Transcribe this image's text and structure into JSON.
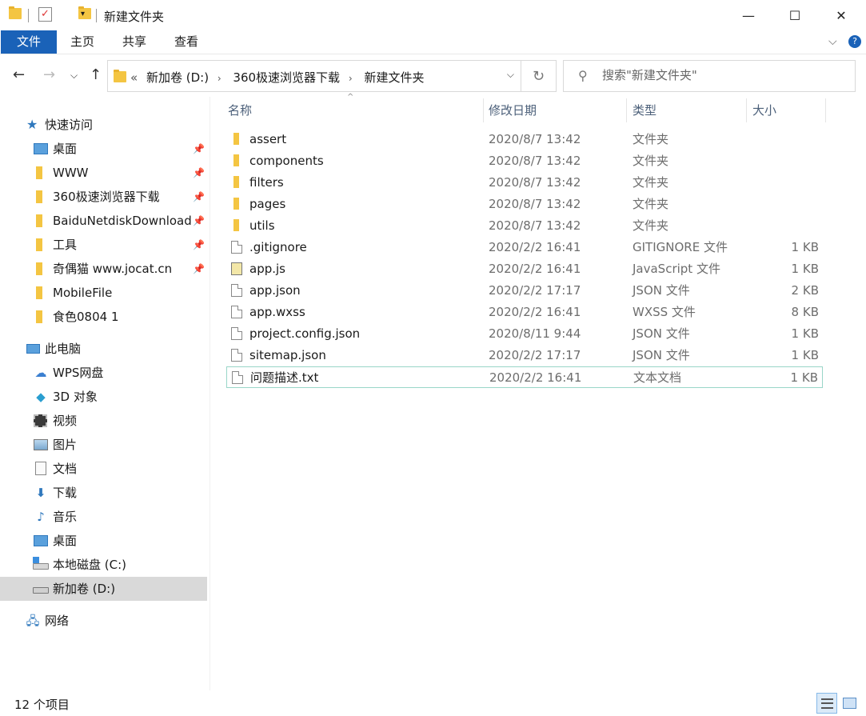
{
  "window": {
    "title": "新建文件夹",
    "minimize_glyph": "—",
    "maximize_glyph": "☐",
    "close_glyph": "✕"
  },
  "ribbon": {
    "tabs": [
      "文件",
      "主页",
      "共享",
      "查看"
    ],
    "expand_glyph": "⌵",
    "help_glyph": "?"
  },
  "address": {
    "crumbs": [
      "新加卷 (D:)",
      "360极速浏览器下载",
      "新建文件夹"
    ],
    "overflow": "«",
    "separator": "›",
    "dropdown_glyph": "⌵"
  },
  "search": {
    "placeholder": "搜索\"新建文件夹\""
  },
  "nav": {
    "back": "←",
    "forward": "→",
    "recent": "⌵",
    "up": "↑",
    "refresh": "↻"
  },
  "sidebar": {
    "items": [
      {
        "label": "快速访问",
        "icon": "star-icon",
        "pinned": false
      },
      {
        "label": "桌面",
        "icon": "desktop-icon",
        "pinned": true
      },
      {
        "label": "WWW",
        "icon": "folder-icon",
        "pinned": true
      },
      {
        "label": "360极速浏览器下载",
        "icon": "folder-icon",
        "pinned": true
      },
      {
        "label": "BaiduNetdiskDownload",
        "icon": "folder-icon",
        "pinned": true
      },
      {
        "label": "工具",
        "icon": "folder-icon",
        "pinned": true
      },
      {
        "label": "奇偶猫 www.jocat.cn",
        "icon": "folder-icon",
        "pinned": true
      },
      {
        "label": "MobileFile",
        "icon": "folder-icon",
        "pinned": false
      },
      {
        "label": "食色0804 1",
        "icon": "folder-icon",
        "pinned": false
      },
      {
        "label": "此电脑",
        "icon": "computer-icon",
        "pinned": false
      },
      {
        "label": "WPS网盘",
        "icon": "cloud-icon",
        "pinned": false
      },
      {
        "label": "3D 对象",
        "icon": "cube-icon",
        "pinned": false
      },
      {
        "label": "视频",
        "icon": "video-icon",
        "pinned": false
      },
      {
        "label": "图片",
        "icon": "picture-icon",
        "pinned": false
      },
      {
        "label": "文档",
        "icon": "document-icon",
        "pinned": false
      },
      {
        "label": "下载",
        "icon": "download-icon",
        "pinned": false
      },
      {
        "label": "音乐",
        "icon": "music-icon",
        "pinned": false
      },
      {
        "label": "桌面",
        "icon": "desktop-icon",
        "pinned": false
      },
      {
        "label": "本地磁盘 (C:)",
        "icon": "drive-icon",
        "pinned": false
      },
      {
        "label": "新加卷 (D:)",
        "icon": "drive-icon",
        "pinned": false,
        "selected": true
      },
      {
        "label": "网络",
        "icon": "network-icon",
        "pinned": false
      }
    ],
    "pin_glyph": "📌"
  },
  "filelist": {
    "columns": [
      "名称",
      "修改日期",
      "类型",
      "大小"
    ],
    "sort_glyph": "^",
    "rows": [
      {
        "name": "assert",
        "date": "2020/8/7 13:42",
        "type": "文件夹",
        "size": "",
        "kind": "folder"
      },
      {
        "name": "components",
        "date": "2020/8/7 13:42",
        "type": "文件夹",
        "size": "",
        "kind": "folder"
      },
      {
        "name": "filters",
        "date": "2020/8/7 13:42",
        "type": "文件夹",
        "size": "",
        "kind": "folder"
      },
      {
        "name": "pages",
        "date": "2020/8/7 13:42",
        "type": "文件夹",
        "size": "",
        "kind": "folder"
      },
      {
        "name": "utils",
        "date": "2020/8/7 13:42",
        "type": "文件夹",
        "size": "",
        "kind": "folder"
      },
      {
        "name": ".gitignore",
        "date": "2020/2/2 16:41",
        "type": "GITIGNORE 文件",
        "size": "1 KB",
        "kind": "doc"
      },
      {
        "name": "app.js",
        "date": "2020/2/2 16:41",
        "type": "JavaScript 文件",
        "size": "1 KB",
        "kind": "js"
      },
      {
        "name": "app.json",
        "date": "2020/2/2 17:17",
        "type": "JSON 文件",
        "size": "2 KB",
        "kind": "doc"
      },
      {
        "name": "app.wxss",
        "date": "2020/2/2 16:41",
        "type": "WXSS 文件",
        "size": "8 KB",
        "kind": "doc"
      },
      {
        "name": "project.config.json",
        "date": "2020/8/11 9:44",
        "type": "JSON 文件",
        "size": "1 KB",
        "kind": "doc"
      },
      {
        "name": "sitemap.json",
        "date": "2020/2/2 17:17",
        "type": "JSON 文件",
        "size": "1 KB",
        "kind": "doc"
      },
      {
        "name": "问题描述.txt",
        "date": "2020/2/2 16:41",
        "type": "文本文档",
        "size": "1 KB",
        "kind": "doc",
        "focused": true
      }
    ]
  },
  "status": {
    "item_count": "12 个项目"
  },
  "colors": {
    "accent": "#1a62b8",
    "folder": "#f4c542",
    "selected_row": "#d9d9d9",
    "focus_border": "#99d6c8"
  }
}
